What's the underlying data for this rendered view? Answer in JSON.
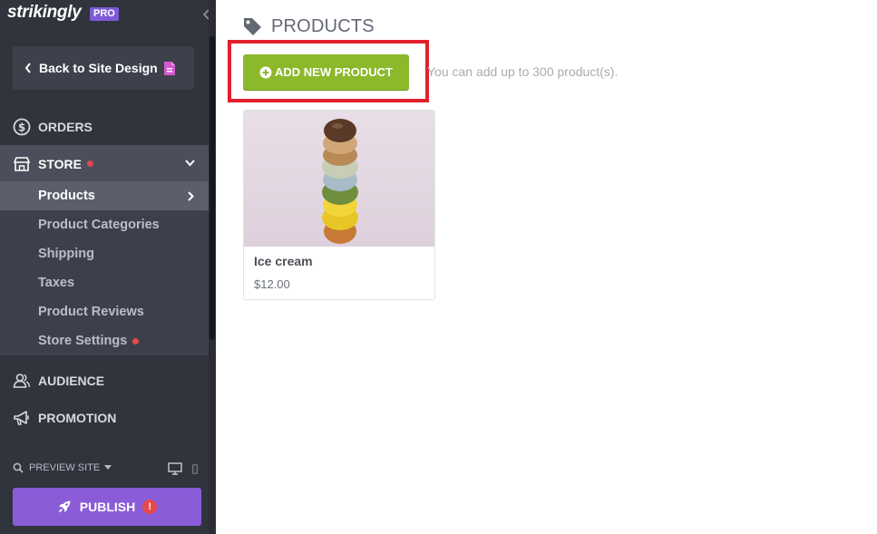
{
  "sidebar": {
    "brand": "strikingly",
    "plan_badge": "PRO",
    "back_label": "Back to Site Design",
    "nav": {
      "orders": "ORDERS",
      "store": "STORE",
      "audience": "AUDIENCE",
      "promotion": "PROMOTION"
    },
    "store_items": [
      {
        "label": "Products"
      },
      {
        "label": "Product Categories"
      },
      {
        "label": "Shipping"
      },
      {
        "label": "Taxes"
      },
      {
        "label": "Product Reviews"
      },
      {
        "label": "Store Settings"
      }
    ],
    "preview_label": "PREVIEW SITE",
    "publish_label": "PUBLISH",
    "publish_alert": "!"
  },
  "main": {
    "title": "PRODUCTS",
    "add_button_label": "ADD NEW PRODUCT",
    "limit_text": "You can add up to 300 product(s).",
    "products": [
      {
        "name": "Ice cream",
        "price": "$12.00"
      }
    ]
  },
  "colors": {
    "sidebar_bg": "#30343d",
    "accent_purple": "#8b5cd8",
    "add_button_green": "#8cb92b",
    "highlight_red": "#e0212d",
    "status_dot_red": "#e5484d"
  },
  "icons": [
    "collapse-chevron-icon",
    "back-chevron-icon",
    "document-icon",
    "dollar-circle-icon",
    "store-icon",
    "chevron-down-icon",
    "chevron-right-icon",
    "audience-icon",
    "megaphone-icon",
    "search-icon",
    "caret-down-icon",
    "desktop-icon",
    "mobile-icon",
    "rocket-icon",
    "tag-icon",
    "plus-circle-icon"
  ]
}
